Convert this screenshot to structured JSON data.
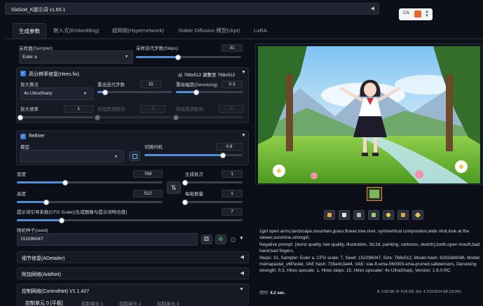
{
  "app": {
    "title": "SixGod_K提示词 v1.65.1",
    "collapse": "◀",
    "lang": "CN"
  },
  "tabs": [
    "生成参数",
    "嵌入式(Embedding)",
    "超网络(Hypernetwork)",
    "Stable Diffusion 模型(ckpt)",
    "LoRA"
  ],
  "sampler": {
    "label": "采样器(Sampler)",
    "value": "Euler a",
    "steps_label": "采样迭代步数(Steps)",
    "steps": "31",
    "steps_frac": 0.4
  },
  "hires": {
    "title": "高分辨率修复(Hires.fix)",
    "size_info": "从 768x512 调整至 768x512",
    "upscaler_label": "放大算法",
    "upscaler": "4x-UltraSharp",
    "steps_label": "重设迭代步数",
    "steps": "15",
    "steps_frac": 0.1,
    "denoise_label": "重绘幅度(Denoising)",
    "denoise": "0.3",
    "denoise_frac": 0.3,
    "scale_label": "放大倍率",
    "scale": "1",
    "scale_frac": 0.0,
    "width_label": "将宽度调整到",
    "width": "0",
    "height_label": "将高度调整到",
    "height": "0"
  },
  "refiner": {
    "title": "Refiner",
    "model_label": "模型",
    "switch_label": "切换时机",
    "switch": "0.8",
    "switch_frac": 0.8
  },
  "size": {
    "width_label": "宽度",
    "width": "768",
    "width_frac": 0.33,
    "height_label": "高度",
    "height": "512",
    "height_frac": 0.2,
    "batch_count_label": "生成批次",
    "batch_count": "1",
    "batch_count_frac": 0.0,
    "batch_size_label": "每批数量",
    "batch_size": "1",
    "batch_size_frac": 0.0
  },
  "cfg": {
    "label": "提示词引导系数(CFG Scale)(生成图像与提示词吻合度)",
    "value": "7",
    "frac": 0.2
  },
  "seed": {
    "label": "随机种子(seed)",
    "value": "151096047"
  },
  "sections": [
    "细节修复(ADetailer)",
    "附加网络(AddNet)",
    "控制网络(ControlNet) V1.1.427"
  ],
  "controlnet_tabs": [
    "控制单元 0 [平板]",
    "控制单元 1",
    "控制单元 2",
    "控制单元 3"
  ],
  "info": {
    "prompt": "1girl open arms,landscape,mountain,grass,flower,tree,river, symmetrical composition,wide shot,look at the viewer,sunshine,ximixgirl,",
    "negative": "Negative prompt: (worst quality, low quality, illustration, 3d,2d, painting, cartoons, sketch),tooth,open mouth,bad hand,bad fingers,",
    "params": "Steps: 31, Sampler: Euler a, CFG scale: 7, Seed: 151096047, Size: 768x512, Model hash: 6292dd40d6, Model: meinapastel_v6Pastel, VAE hash: 735e4c3a44, VAE: vae-ft-ema-560000-ema-pruned.safetensors, Denoising strength: 0.3, Hires upscale: 1, Hires steps: 15, Hires upscaler: 4x-UltraSharp, Version: 1.6.0-RC"
  },
  "footer": {
    "time_label": "用时:",
    "time": "4.2 sec.",
    "vram": "A: 3.58 GB, R: 4.35 GB, Sys: 4.7/23.6914 GB (19.9%)"
  },
  "colors": {
    "accent": "#3b7ddd",
    "slider": "#4f8fd8",
    "background": "#0c0f18",
    "panel": "#151a24"
  }
}
